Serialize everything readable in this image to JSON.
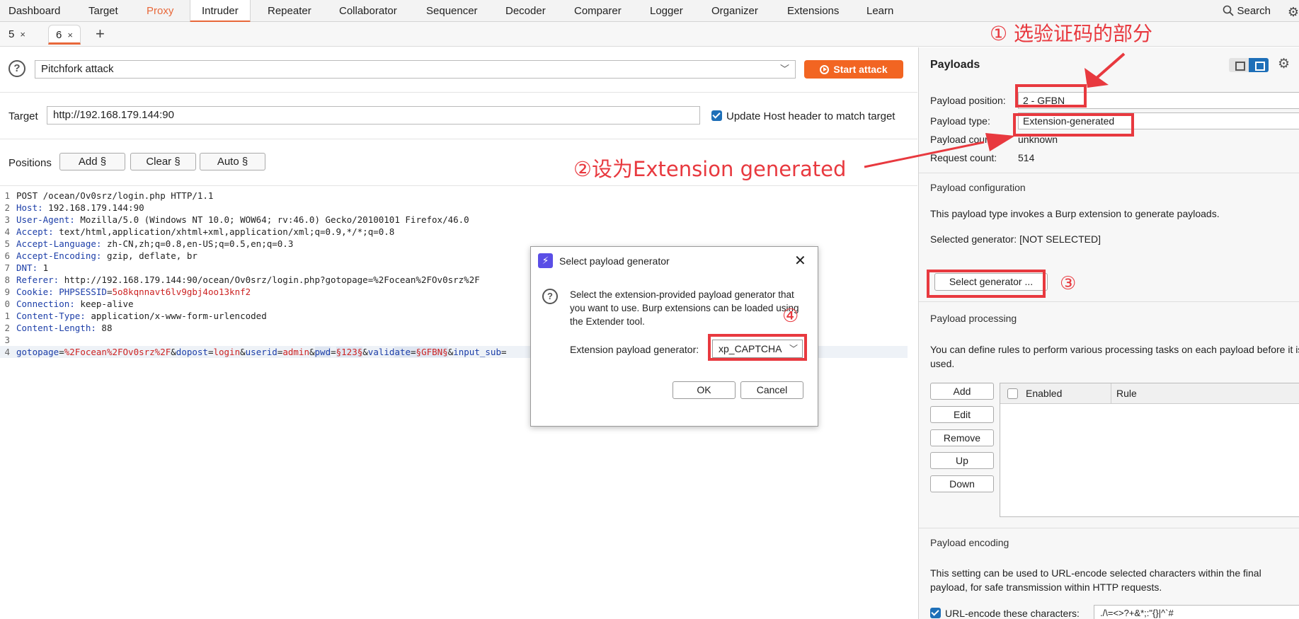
{
  "menu": {
    "items": [
      "Dashboard",
      "Target",
      "Proxy",
      "Intruder",
      "Repeater",
      "Collaborator",
      "Sequencer",
      "Decoder",
      "Comparer",
      "Logger",
      "Organizer",
      "Extensions",
      "Learn"
    ],
    "search_label": "Search",
    "active": "Intruder",
    "accent_color": "#e8683a"
  },
  "tabs": {
    "items": [
      {
        "label": "5",
        "close": "×"
      },
      {
        "label": "6",
        "close": "×"
      }
    ],
    "add": "+"
  },
  "attack": {
    "type": "Pitchfork attack",
    "start_label": "Start attack"
  },
  "target": {
    "label": "Target",
    "value": "http://192.168.179.144:90",
    "update_host_label": "Update Host header to match target",
    "update_host_checked": true
  },
  "positions": {
    "label": "Positions",
    "add_btn": "Add §",
    "clear_btn": "Clear §",
    "auto_btn": "Auto §"
  },
  "request": {
    "line_numbers": [
      "1",
      "2",
      "3",
      "4",
      "5",
      "6",
      "7",
      "8",
      "9",
      "0",
      "1",
      "2",
      "3",
      "4"
    ],
    "l1": "POST /ocean/Ov0srz/login.php HTTP/1.1",
    "h_host_k": "Host:",
    "h_host_v": " 192.168.179.144:90",
    "h_ua_k": "User-Agent:",
    "h_ua_v": " Mozilla/5.0 (Windows NT 10.0; WOW64; rv:46.0) Gecko/20100101 Firefox/46.0",
    "h_acc_k": "Accept:",
    "h_acc_v": " text/html,application/xhtml+xml,application/xml;q=0.9,*/*;q=0.8",
    "h_lang_k": "Accept-Language:",
    "h_lang_v": " zh-CN,zh;q=0.8,en-US;q=0.5,en;q=0.3",
    "h_enc_k": "Accept-Encoding:",
    "h_enc_v": " gzip, deflate, br",
    "h_dnt_k": "DNT:",
    "h_dnt_v": " 1",
    "h_ref_k": "Referer:",
    "h_ref_v": " http://192.168.179.144:90/ocean/Ov0srz/login.php?gotopage=%2Focean%2FOv0srz%2F",
    "h_cookie_k": "Cookie:",
    "h_cookie_n": " PHPSESSID",
    "h_cookie_eq": "=",
    "h_cookie_v": "5o8kqnnavt6lv9gbj4oo13knf2",
    "h_conn_k": "Connection:",
    "h_conn_v": " keep-alive",
    "h_ct_k": "Content-Type:",
    "h_ct_v": " application/x-www-form-urlencoded",
    "h_cl_k": "Content-Length:",
    "h_cl_v": " 88",
    "body": {
      "p1": "gotopage",
      "e1": "=",
      "v1": "%2Focean%2FOv0srz%2F",
      "a1": "&",
      "p2": "dopost",
      "e2": "=",
      "v2": "login",
      "a2": "&",
      "p3": "userid",
      "e3": "=",
      "v3": "admin",
      "a3": "&",
      "p4": "pwd",
      "e4": "=",
      "v4": "§123§",
      "a4": "&",
      "p5": "valid",
      "p5b": "ate",
      "e5": "=",
      "v5": "§GFBN§",
      "a5": "&",
      "p6": "input_sub",
      "e6": "="
    }
  },
  "payloads": {
    "title": "Payloads",
    "position_label": "Payload position:",
    "position_value": "2 - GFBN",
    "type_label": "Payload type:",
    "type_value": "Extension-generated",
    "count_label": "Payload count:",
    "count_value": "unknown",
    "request_label": "Request count:",
    "request_value": "514",
    "config_title": "Payload configuration",
    "config_text": "This payload type invokes a Burp extension to generate payloads.",
    "selected_gen": "Selected generator: [NOT SELECTED]",
    "select_btn": "Select generator ...",
    "processing_title": "Payload processing",
    "processing_text": "You can define rules to perform various processing tasks on each payload before it is used.",
    "proc_buttons": [
      "Add",
      "Edit",
      "Remove",
      "Up",
      "Down"
    ],
    "rules_cols": [
      "Enabled",
      "Rule"
    ],
    "encoding_title": "Payload encoding",
    "encoding_text": "This setting can be used to URL-encode selected characters within the final payload, for safe transmission within HTTP requests.",
    "url_encode_label": "URL-encode these characters:",
    "url_encode_value": "./\\=<>?+&*;:\"{}|^`#"
  },
  "dialog": {
    "title": "Select payload generator",
    "text": "Select the extension-provided payload generator that you want to use. Burp extensions can be loaded using the Extender tool.",
    "gen_label": "Extension payload generator:",
    "gen_value": "xp_CAPTCHA",
    "ok": "OK",
    "cancel": "Cancel"
  },
  "annotations": {
    "a1": "① 选验证码的部分",
    "a2": "②设为Extension generated",
    "a3": "③",
    "a4": "④",
    "color": "#e8393f"
  }
}
